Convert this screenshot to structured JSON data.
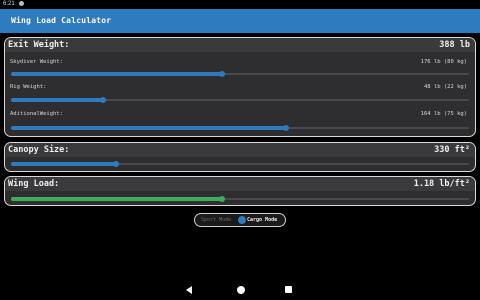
{
  "status_bar": {
    "time": "6:21"
  },
  "app": {
    "title": "Wing Load Calculator"
  },
  "exit_weight": {
    "title": "Exit Weight:",
    "total": "388 lb",
    "rows": [
      {
        "label": "Skydiver Weight:",
        "value": "176 lb (80 kg)",
        "fraction": 0.46
      },
      {
        "label": "Rig Weight:",
        "value": "48 lb (22 kg)",
        "fraction": 0.2
      },
      {
        "label": "AditionalWeight:",
        "value": "164 lb (75 kg)",
        "fraction": 0.6
      }
    ]
  },
  "canopy": {
    "title": "Canopy Size:",
    "value": "330 ft²",
    "fraction": 0.23
  },
  "wing_load": {
    "title": "Wing Load:",
    "value": "1.18 lb/ft²",
    "fraction": 0.46
  },
  "mode": {
    "sport_label": "Sport Mode",
    "cargo_label": "Cargo Mode",
    "selected": "Cargo Mode"
  },
  "colors": {
    "accent": "#2f7bbf",
    "wing_load": "#3cae5a",
    "card": "#2e2e30"
  }
}
